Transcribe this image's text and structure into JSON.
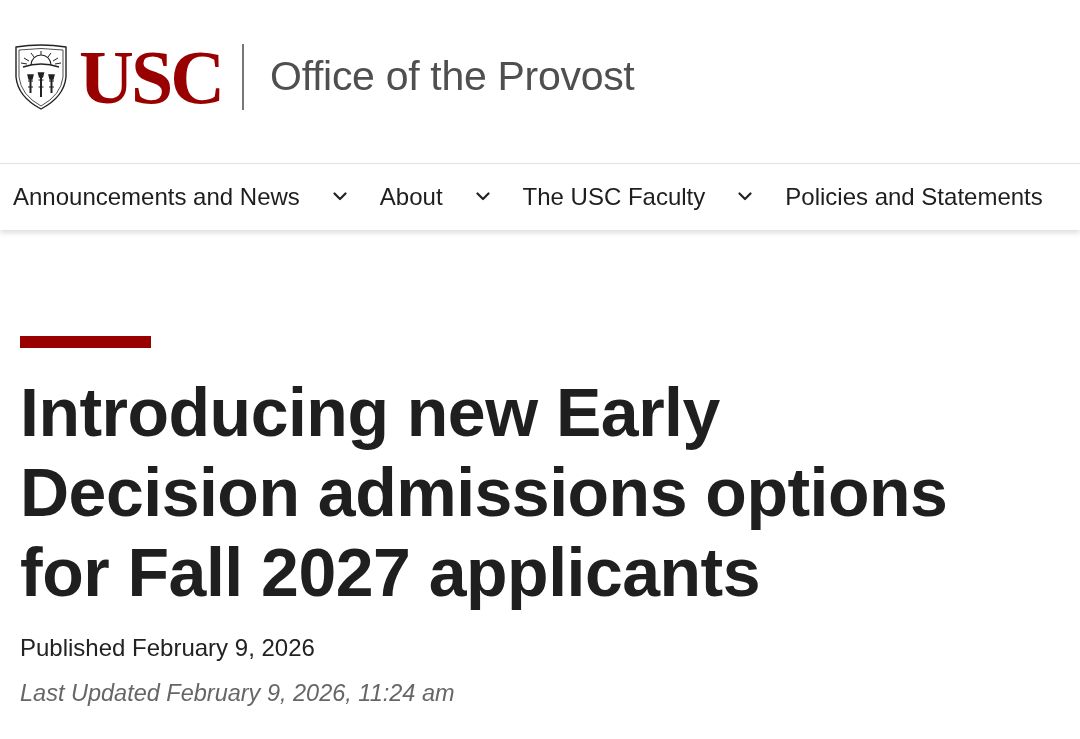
{
  "header": {
    "wordmark": "USC",
    "site_title": "Office of the Provost"
  },
  "nav": {
    "items": [
      {
        "label": "Announcements and News",
        "has_submenu": true
      },
      {
        "label": "About",
        "has_submenu": true
      },
      {
        "label": "The USC Faculty",
        "has_submenu": true
      },
      {
        "label": "Policies and Statements",
        "has_submenu": false
      }
    ]
  },
  "article": {
    "title": "Introducing new Early Decision admissions options for Fall 2027 applicants",
    "published": "Published February 9, 2026",
    "last_updated": "Last Updated February 9, 2026, 11:24 am"
  }
}
